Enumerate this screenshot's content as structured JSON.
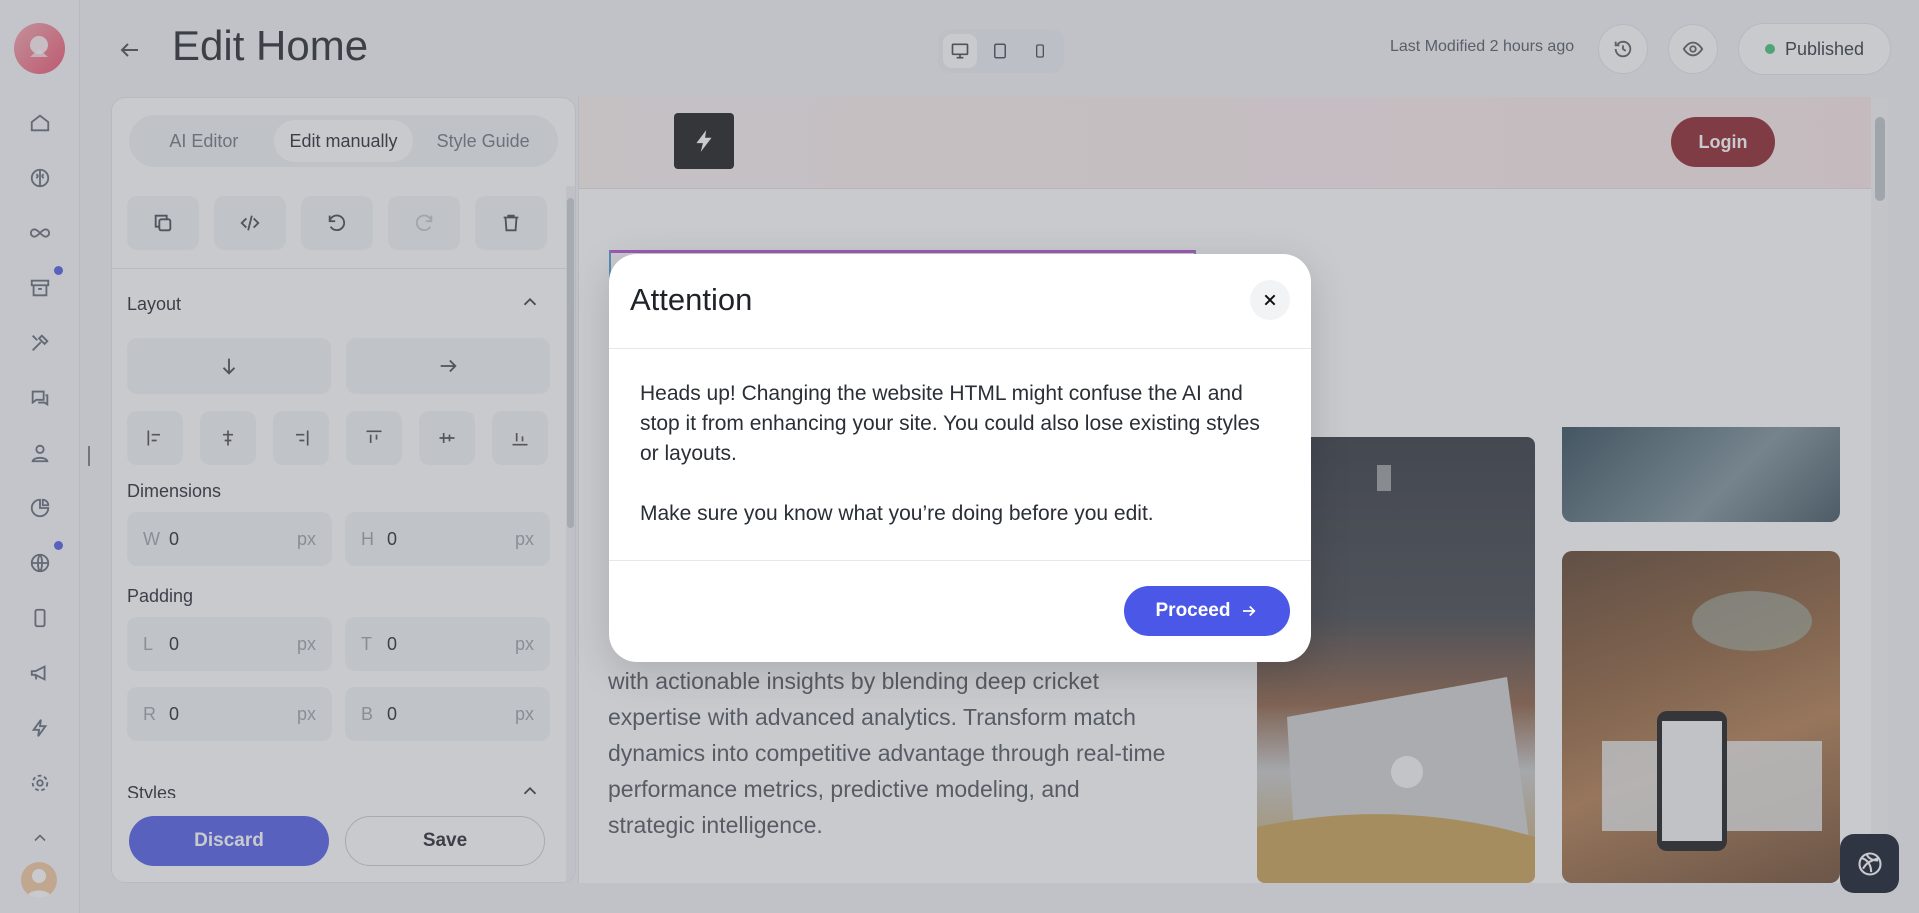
{
  "header": {
    "title": "Edit Home",
    "last_modified": "Last Modified 2 hours ago",
    "status": "Published"
  },
  "rail": {
    "icons": [
      "home-icon",
      "brain-icon",
      "infinity-icon",
      "archive-icon",
      "tools-icon",
      "chat-icon",
      "user-icon",
      "pie-chart-icon",
      "globe-icon",
      "mobile-icon",
      "megaphone-icon",
      "lightning-icon",
      "gear-icon",
      "chevron-up-icon"
    ]
  },
  "panel": {
    "tabs": [
      "AI Editor",
      "Edit manually",
      "Style Guide"
    ],
    "active_tab": "Edit manually",
    "layout_title": "Layout",
    "dimensions_title": "Dimensions",
    "padding_title": "Padding",
    "styles_title": "Styles",
    "width": {
      "prefix": "W",
      "value": "0",
      "unit": "px"
    },
    "height": {
      "prefix": "H",
      "value": "0",
      "unit": "px"
    },
    "pad_left": {
      "prefix": "L",
      "value": "0",
      "unit": "px"
    },
    "pad_top": {
      "prefix": "T",
      "value": "0",
      "unit": "px"
    },
    "pad_right": {
      "prefix": "R",
      "value": "0",
      "unit": "px"
    },
    "pad_bottom": {
      "prefix": "B",
      "value": "0",
      "unit": "px"
    },
    "discard_label": "Discard",
    "save_label": "Save"
  },
  "preview": {
    "login_label": "Login",
    "body_text": "with actionable insights by blending deep cricket expertise with advanced analytics. Transform match dynamics into competitive advantage through real-time performance metrics, predictive modeling, and strategic intelligence."
  },
  "modal": {
    "title": "Attention",
    "paragraph1": "Heads up! Changing the website HTML might confuse the AI and stop it from enhancing your site. You could also lose existing styles or layouts.",
    "paragraph2": "Make sure you know what you’re doing before you edit.",
    "proceed_label": "Proceed"
  },
  "colors": {
    "accent": "#4b57e6",
    "login": "#8c1a22",
    "published_dot": "#3fbf6e"
  }
}
